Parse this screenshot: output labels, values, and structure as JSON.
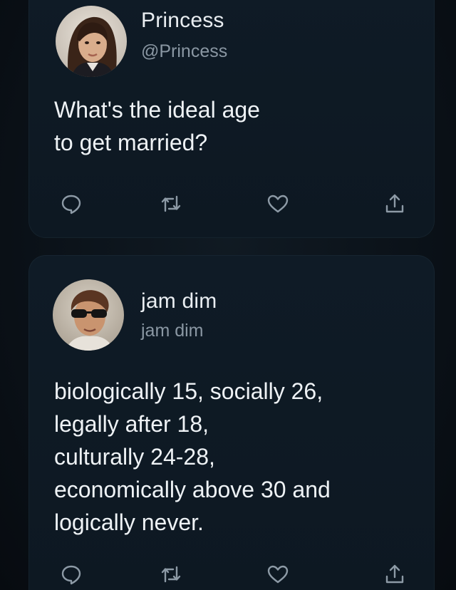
{
  "tweets": [
    {
      "name": "Princess",
      "handle": "@Princess",
      "text_lines": [
        "What's the ideal age",
        "to get married?"
      ]
    },
    {
      "name": "jam dim",
      "handle": "jam dim",
      "text_lines": [
        "biologically 15, socially 26,",
        "legally after 18,",
        "culturally 24-28,",
        "economically above 30 and",
        "logically never."
      ]
    }
  ],
  "icons": {
    "reply": "reply-icon",
    "retweet": "retweet-icon",
    "like": "heart-icon",
    "share": "share-icon"
  },
  "colors": {
    "background": "#0b1117",
    "card": "#0f1b26",
    "text": "#eef2f5",
    "muted": "#8a97a3"
  }
}
